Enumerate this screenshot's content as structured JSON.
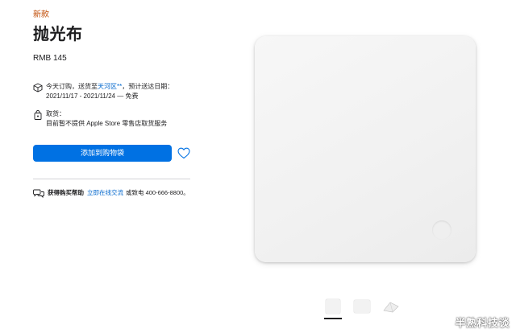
{
  "product": {
    "badge": "新款",
    "title": "抛光布",
    "price": "RMB 145"
  },
  "delivery": {
    "icon": "box-icon",
    "prefix": "今天订购，送货至",
    "location": "天河区**",
    "suffix": "，预计送达日期：",
    "dates": "2021/11/17 - 2021/11/24 — 免费"
  },
  "pickup": {
    "icon": "store-bag-icon",
    "label": "取货：",
    "status": "目前暂不提供 Apple Store 零售店取货服务"
  },
  "actions": {
    "add_to_bag": "添加到购物袋",
    "favorite_icon": "heart-icon"
  },
  "help": {
    "icon": "chat-icon",
    "label": "获得购买帮助",
    "link": "立即在线交流",
    "phone": "或致电 400-666-8800。"
  },
  "gallery": {
    "thumbnails": [
      "polishing-cloth-front",
      "polishing-cloth-flat",
      "polishing-cloth-folded"
    ],
    "selected_index": 0
  },
  "watermark": "半熟科技谈",
  "colors": {
    "accent": "#0071e3",
    "link": "#0066cc",
    "badge": "#bf4800"
  }
}
